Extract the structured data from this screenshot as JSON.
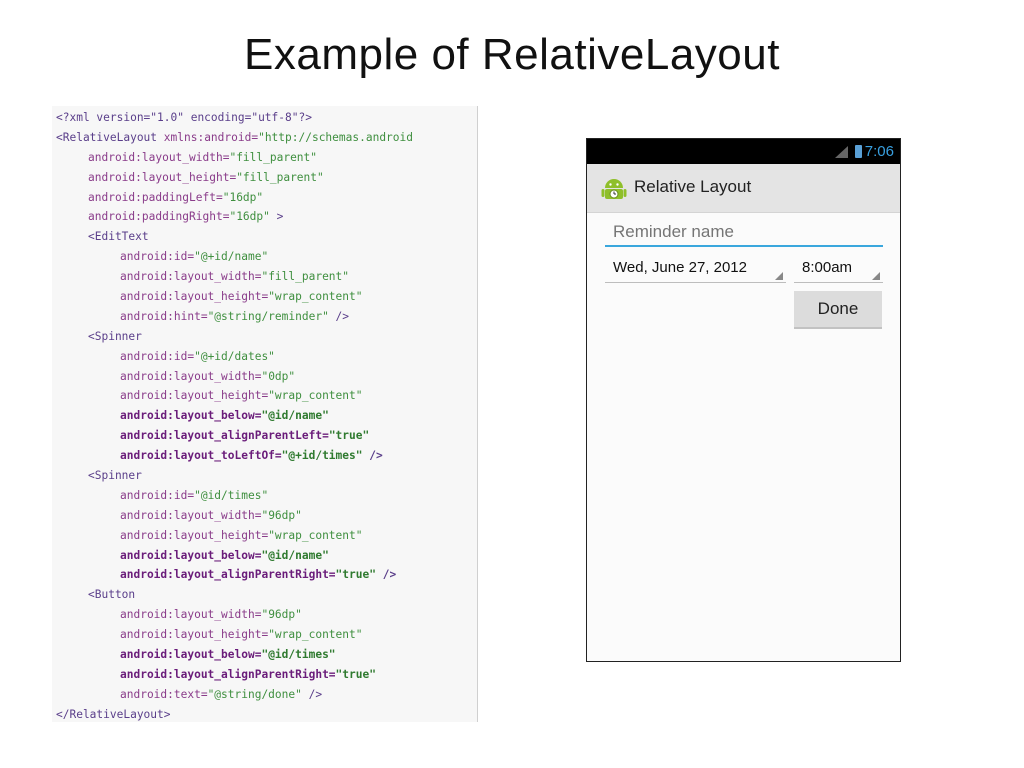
{
  "slide": {
    "title": "Example of RelativeLayout"
  },
  "code": [
    {
      "indent": 0,
      "bold": false,
      "parts": [
        [
          "tag",
          "<?xml version=\"1.0\" encoding=\"utf-8\"?>"
        ]
      ]
    },
    {
      "indent": 0,
      "bold": false,
      "parts": [
        [
          "tag",
          "<RelativeLayout "
        ],
        [
          "attr",
          "xmlns:android="
        ],
        [
          "val",
          "\"http://schemas.android"
        ]
      ]
    },
    {
      "indent": 1,
      "bold": false,
      "parts": [
        [
          "attr",
          "android:layout_width="
        ],
        [
          "val",
          "\"fill_parent\""
        ]
      ]
    },
    {
      "indent": 1,
      "bold": false,
      "parts": [
        [
          "attr",
          "android:layout_height="
        ],
        [
          "val",
          "\"fill_parent\""
        ]
      ]
    },
    {
      "indent": 1,
      "bold": false,
      "parts": [
        [
          "attr",
          "android:paddingLeft="
        ],
        [
          "val",
          "\"16dp\""
        ]
      ]
    },
    {
      "indent": 1,
      "bold": false,
      "parts": [
        [
          "attr",
          "android:paddingRight="
        ],
        [
          "val",
          "\"16dp\""
        ],
        [
          "tag",
          " >"
        ]
      ]
    },
    {
      "indent": 1,
      "bold": false,
      "parts": [
        [
          "tag",
          "<EditText"
        ]
      ]
    },
    {
      "indent": 2,
      "bold": false,
      "parts": [
        [
          "attr",
          "android:id="
        ],
        [
          "val",
          "\"@+id/name\""
        ]
      ]
    },
    {
      "indent": 2,
      "bold": false,
      "parts": [
        [
          "attr",
          "android:layout_width="
        ],
        [
          "val",
          "\"fill_parent\""
        ]
      ]
    },
    {
      "indent": 2,
      "bold": false,
      "parts": [
        [
          "attr",
          "android:layout_height="
        ],
        [
          "val",
          "\"wrap_content\""
        ]
      ]
    },
    {
      "indent": 2,
      "bold": false,
      "parts": [
        [
          "attr",
          "android:hint="
        ],
        [
          "val",
          "\"@string/reminder\""
        ],
        [
          "tag",
          " />"
        ]
      ]
    },
    {
      "indent": 1,
      "bold": false,
      "parts": [
        [
          "tag",
          "<Spinner"
        ]
      ]
    },
    {
      "indent": 2,
      "bold": false,
      "parts": [
        [
          "attr",
          "android:id="
        ],
        [
          "val",
          "\"@+id/dates\""
        ]
      ]
    },
    {
      "indent": 2,
      "bold": false,
      "parts": [
        [
          "attr",
          "android:layout_width="
        ],
        [
          "val",
          "\"0dp\""
        ]
      ]
    },
    {
      "indent": 2,
      "bold": false,
      "parts": [
        [
          "attr",
          "android:layout_height="
        ],
        [
          "val",
          "\"wrap_content\""
        ]
      ]
    },
    {
      "indent": 2,
      "bold": true,
      "parts": [
        [
          "attr",
          "android:layout_below="
        ],
        [
          "val",
          "\"@id/name\""
        ]
      ]
    },
    {
      "indent": 2,
      "bold": true,
      "parts": [
        [
          "attr",
          "android:layout_alignParentLeft="
        ],
        [
          "val",
          "\"true\""
        ]
      ]
    },
    {
      "indent": 2,
      "bold": true,
      "parts": [
        [
          "attr",
          "android:layout_toLeftOf="
        ],
        [
          "val",
          "\"@+id/times\""
        ],
        [
          "tag",
          " />"
        ]
      ]
    },
    {
      "indent": 1,
      "bold": false,
      "parts": [
        [
          "tag",
          "<Spinner"
        ]
      ]
    },
    {
      "indent": 2,
      "bold": false,
      "parts": [
        [
          "attr",
          "android:id="
        ],
        [
          "val",
          "\"@id/times\""
        ]
      ]
    },
    {
      "indent": 2,
      "bold": false,
      "parts": [
        [
          "attr",
          "android:layout_width="
        ],
        [
          "val",
          "\"96dp\""
        ]
      ]
    },
    {
      "indent": 2,
      "bold": false,
      "parts": [
        [
          "attr",
          "android:layout_height="
        ],
        [
          "val",
          "\"wrap_content\""
        ]
      ]
    },
    {
      "indent": 2,
      "bold": true,
      "parts": [
        [
          "attr",
          "android:layout_below="
        ],
        [
          "val",
          "\"@id/name\""
        ]
      ]
    },
    {
      "indent": 2,
      "bold": true,
      "parts": [
        [
          "attr",
          "android:layout_alignParentRight="
        ],
        [
          "val",
          "\"true\""
        ],
        [
          "tag",
          " />"
        ]
      ]
    },
    {
      "indent": 1,
      "bold": false,
      "parts": [
        [
          "tag",
          "<Button"
        ]
      ]
    },
    {
      "indent": 2,
      "bold": false,
      "parts": [
        [
          "attr",
          "android:layout_width="
        ],
        [
          "val",
          "\"96dp\""
        ]
      ]
    },
    {
      "indent": 2,
      "bold": false,
      "parts": [
        [
          "attr",
          "android:layout_height="
        ],
        [
          "val",
          "\"wrap_content\""
        ]
      ]
    },
    {
      "indent": 2,
      "bold": true,
      "parts": [
        [
          "attr",
          "android:layout_below="
        ],
        [
          "val",
          "\"@id/times\""
        ]
      ]
    },
    {
      "indent": 2,
      "bold": true,
      "parts": [
        [
          "attr",
          "android:layout_alignParentRight="
        ],
        [
          "val",
          "\"true\""
        ]
      ]
    },
    {
      "indent": 2,
      "bold": false,
      "parts": [
        [
          "attr",
          "android:text="
        ],
        [
          "val",
          "\"@string/done\""
        ],
        [
          "tag",
          " />"
        ]
      ]
    },
    {
      "indent": 0,
      "bold": false,
      "parts": [
        [
          "tag",
          "</RelativeLayout>"
        ]
      ]
    }
  ],
  "phone": {
    "status_time": "7:06",
    "app_title": "Relative Layout",
    "name_placeholder": "Reminder name",
    "date_value": "Wed, June 27, 2012",
    "time_value": "8:00am",
    "done_label": "Done",
    "colors": {
      "accent": "#3aa7dd",
      "status_time": "#39a0e0",
      "android_green": "#8fbf2a"
    }
  }
}
